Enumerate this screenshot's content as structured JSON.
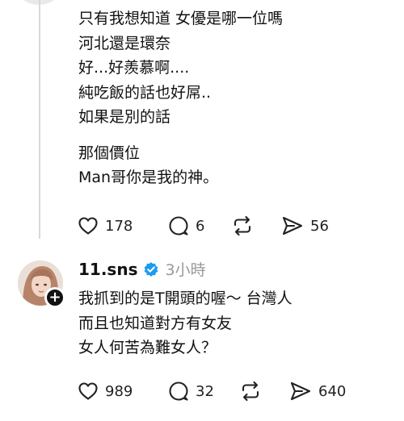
{
  "post1": {
    "lines_a": [
      "只有我想知道 女優是哪一位嗎",
      "河北還是環奈",
      "好...好羨慕啊....",
      "純吃飯的話也好屌..",
      "如果是別的話"
    ],
    "lines_b": [
      "那個價位",
      "Man哥你是我的神。"
    ],
    "likes": "178",
    "replies": "6",
    "shares": "56"
  },
  "post2": {
    "username": "11.sns",
    "time": "3小時",
    "lines": [
      "我抓到的是T開頭的喔～ 台灣人",
      "而且也知道對方有女友",
      "女人何苦為難女人？"
    ],
    "likes": "989",
    "replies": "32",
    "shares": "640"
  },
  "icons": {
    "like": "heart-icon",
    "reply": "comment-icon",
    "repost": "repost-icon",
    "share": "send-icon",
    "verified": "verified-badge-icon",
    "follow": "plus-icon"
  },
  "colors": {
    "text": "#111111",
    "muted": "#999999",
    "verified": "#1d9bf0",
    "thread_line": "#d9d9d9"
  }
}
